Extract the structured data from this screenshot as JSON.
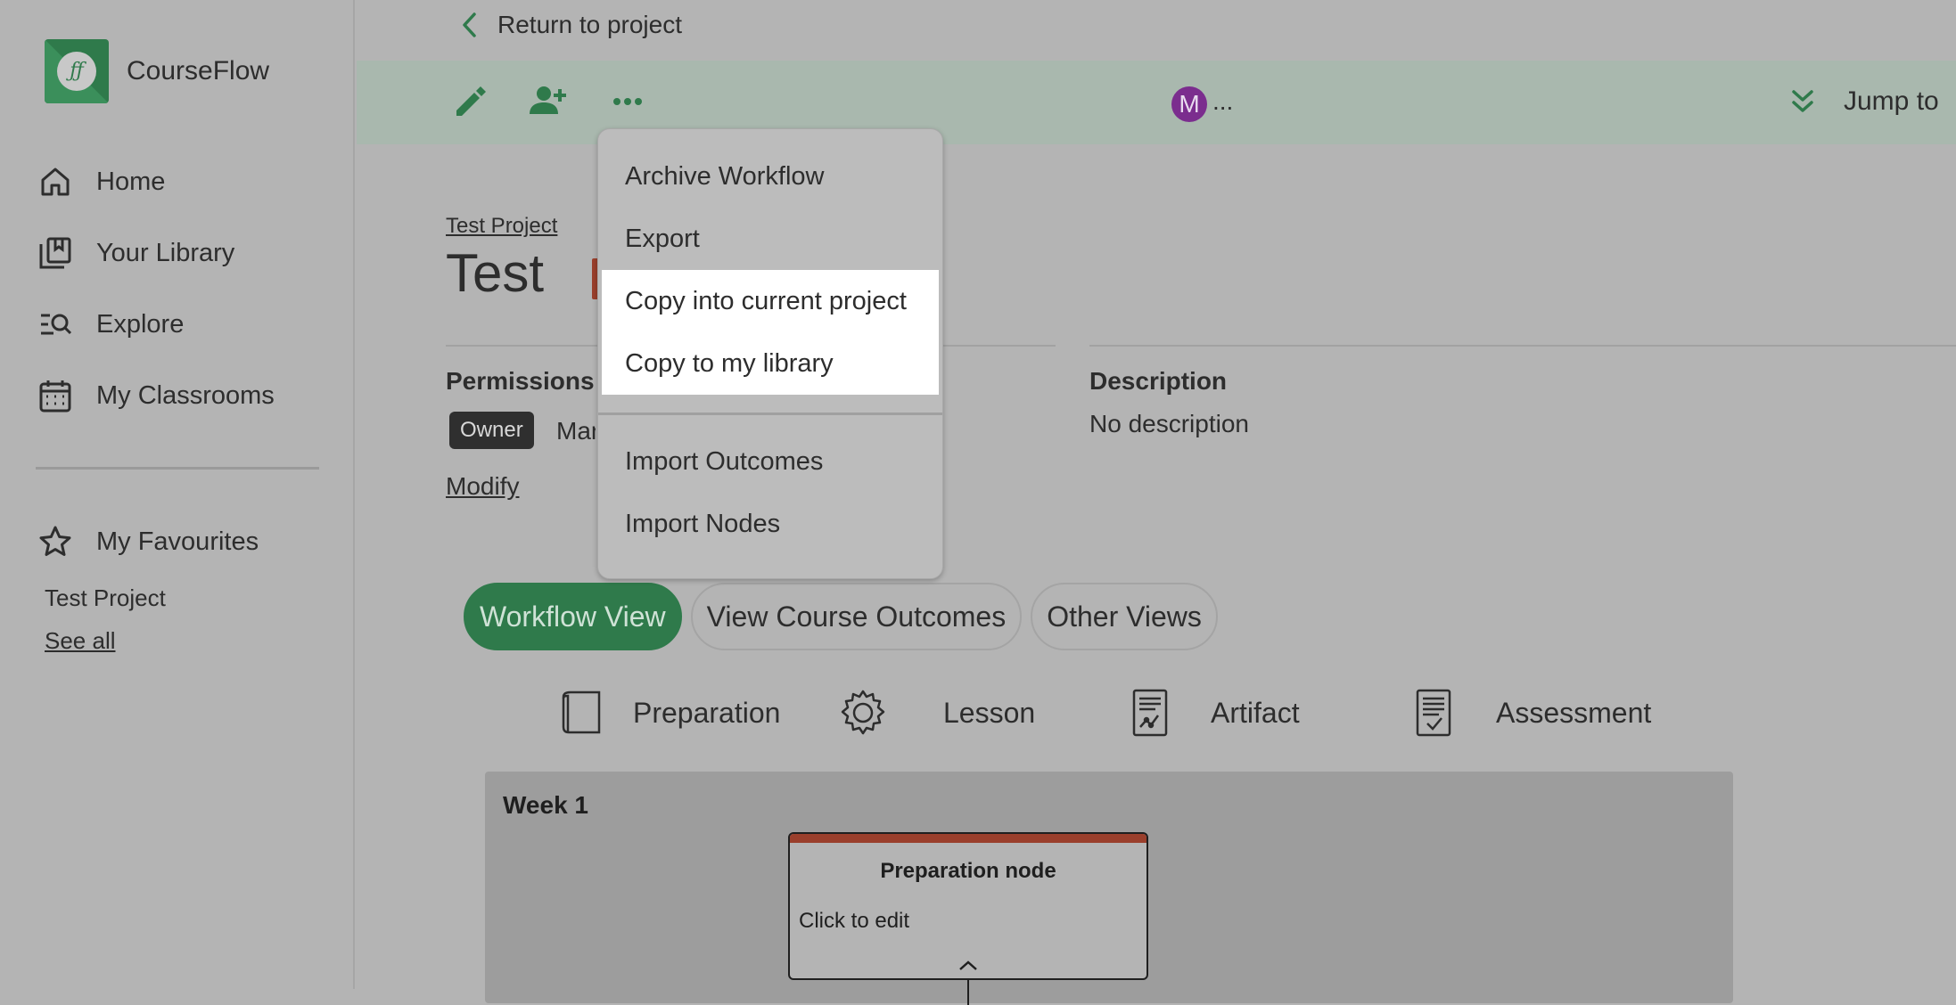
{
  "app": {
    "name": "CourseFlow",
    "logo_mark": "ƒƒ"
  },
  "sidebar": {
    "items": [
      {
        "label": "Home",
        "icon": "home-icon"
      },
      {
        "label": "Your Library",
        "icon": "library-icon"
      },
      {
        "label": "Explore",
        "icon": "explore-icon"
      },
      {
        "label": "My Classrooms",
        "icon": "calendar-icon"
      }
    ],
    "favourites": {
      "label": "My Favourites",
      "icon": "star-icon",
      "items": [
        "Test Project"
      ],
      "see_all": "See all"
    }
  },
  "header": {
    "return_label": "Return to project",
    "avatar_initial": "M",
    "avatar_more": "...",
    "jump_label": "Jump to",
    "toolbar_icons": [
      "pencil-icon",
      "add-user-icon",
      "more-icon"
    ]
  },
  "workflow": {
    "breadcrumb": "Test Project",
    "title": "Test",
    "permissions_label": "Permissions",
    "owner_badge": "Owner",
    "owner_name": "Mar",
    "modify_label": "Modify",
    "description_label": "Description",
    "description_text": "No description"
  },
  "menu": {
    "items": [
      "Archive Workflow",
      "Export",
      "Copy into current project",
      "Copy to my library",
      "Import Outcomes",
      "Import Nodes"
    ]
  },
  "tabs": [
    {
      "label": "Workflow View",
      "active": true
    },
    {
      "label": "View Course Outcomes",
      "active": false
    },
    {
      "label": "Other Views",
      "active": false
    }
  ],
  "legend": [
    {
      "label": "Preparation",
      "icon": "book-icon"
    },
    {
      "label": "Lesson",
      "icon": "gear-icon"
    },
    {
      "label": "Artifact",
      "icon": "artifact-icon"
    },
    {
      "label": "Assessment",
      "icon": "assessment-icon"
    }
  ],
  "week": {
    "title": "Week 1",
    "node": {
      "title": "Preparation node",
      "subtitle": "Click to edit"
    }
  },
  "colors": {
    "accent": "#2f7a4b",
    "node_bar": "#9a3f2c",
    "avatar": "#7b2d8e",
    "highlight": "#ffffff"
  }
}
